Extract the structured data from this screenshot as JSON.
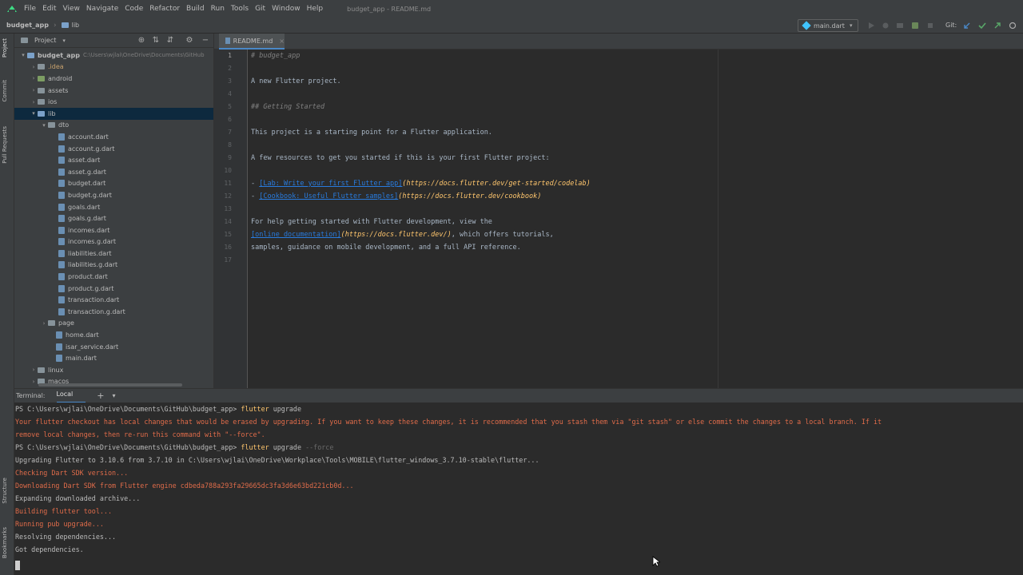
{
  "menubar": {
    "items": [
      "File",
      "Edit",
      "View",
      "Navigate",
      "Code",
      "Refactor",
      "Build",
      "Run",
      "Tools",
      "Git",
      "Window",
      "Help"
    ],
    "window_title": "budget_app - README.md"
  },
  "navbar": {
    "project": "budget_app",
    "folder": "lib",
    "run_config": "main.dart",
    "git_label": "Git:"
  },
  "left_strip": {
    "tabs": [
      "Project",
      "Commit",
      "Pull Requests",
      "Structure",
      "Bookmarks"
    ]
  },
  "project_panel": {
    "title": "Project",
    "tree": [
      {
        "label": "budget_app",
        "path": "C:\\Users\\wjlai\\OneDrive\\Documents\\GitHub",
        "indent": 0,
        "arrow": "▾",
        "type": "folder-blue",
        "bold": true
      },
      {
        "label": ".idea",
        "indent": 1,
        "arrow": "›",
        "type": "folder",
        "idea": true
      },
      {
        "label": "android",
        "indent": 1,
        "arrow": "›",
        "type": "folder-green"
      },
      {
        "label": "assets",
        "indent": 1,
        "arrow": "›",
        "type": "folder"
      },
      {
        "label": "ios",
        "indent": 1,
        "arrow": "›",
        "type": "folder"
      },
      {
        "label": "lib",
        "indent": 1,
        "arrow": "▾",
        "type": "folder-blue",
        "selected": true
      },
      {
        "label": "dto",
        "indent": 2,
        "arrow": "▾",
        "type": "folder"
      },
      {
        "label": "account.dart",
        "indent": 3,
        "arrow": "",
        "type": "file"
      },
      {
        "label": "account.g.dart",
        "indent": 3,
        "arrow": "",
        "type": "file"
      },
      {
        "label": "asset.dart",
        "indent": 3,
        "arrow": "",
        "type": "file"
      },
      {
        "label": "asset.g.dart",
        "indent": 3,
        "arrow": "",
        "type": "file"
      },
      {
        "label": "budget.dart",
        "indent": 3,
        "arrow": "",
        "type": "file"
      },
      {
        "label": "budget.g.dart",
        "indent": 3,
        "arrow": "",
        "type": "file"
      },
      {
        "label": "goals.dart",
        "indent": 3,
        "arrow": "",
        "type": "file"
      },
      {
        "label": "goals.g.dart",
        "indent": 3,
        "arrow": "",
        "type": "file"
      },
      {
        "label": "incomes.dart",
        "indent": 3,
        "arrow": "",
        "type": "file"
      },
      {
        "label": "incomes.g.dart",
        "indent": 3,
        "arrow": "",
        "type": "file"
      },
      {
        "label": "liabilities.dart",
        "indent": 3,
        "arrow": "",
        "type": "file"
      },
      {
        "label": "liabilities.g.dart",
        "indent": 3,
        "arrow": "",
        "type": "file"
      },
      {
        "label": "product.dart",
        "indent": 3,
        "arrow": "",
        "type": "file"
      },
      {
        "label": "product.g.dart",
        "indent": 3,
        "arrow": "",
        "type": "file"
      },
      {
        "label": "transaction.dart",
        "indent": 3,
        "arrow": "",
        "type": "file"
      },
      {
        "label": "transaction.g.dart",
        "indent": 3,
        "arrow": "",
        "type": "file"
      },
      {
        "label": "page",
        "indent": 2,
        "arrow": "›",
        "type": "folder"
      },
      {
        "label": "home.dart",
        "indent": 2,
        "arrow": "",
        "type": "file",
        "noarrow": true
      },
      {
        "label": "isar_service.dart",
        "indent": 2,
        "arrow": "",
        "type": "file",
        "noarrow": true
      },
      {
        "label": "main.dart",
        "indent": 2,
        "arrow": "",
        "type": "file",
        "noarrow": true
      },
      {
        "label": "linux",
        "indent": 1,
        "arrow": "›",
        "type": "folder"
      },
      {
        "label": "macos",
        "indent": 1,
        "arrow": "›",
        "type": "folder"
      }
    ]
  },
  "editor": {
    "tab_label": "README.md",
    "lines": [
      {
        "n": "1",
        "parts": [
          {
            "t": "# budget_app",
            "c": "md-head"
          }
        ]
      },
      {
        "n": "2",
        "parts": []
      },
      {
        "n": "3",
        "parts": [
          {
            "t": "A new Flutter project.",
            "c": ""
          }
        ]
      },
      {
        "n": "4",
        "parts": []
      },
      {
        "n": "5",
        "parts": [
          {
            "t": "## Getting Started",
            "c": "md-head"
          }
        ]
      },
      {
        "n": "6",
        "parts": []
      },
      {
        "n": "7",
        "parts": [
          {
            "t": "This project is a starting point for a Flutter application.",
            "c": ""
          }
        ]
      },
      {
        "n": "8",
        "parts": []
      },
      {
        "n": "9",
        "parts": [
          {
            "t": "A few resources to get you started if this is your first Flutter project:",
            "c": ""
          }
        ]
      },
      {
        "n": "10",
        "parts": []
      },
      {
        "n": "11",
        "parts": [
          {
            "t": "- ",
            "c": ""
          },
          {
            "t": "[Lab: Write your first Flutter app]",
            "c": "md-link"
          },
          {
            "t": "(https://docs.flutter.dev/get-started/codelab)",
            "c": "md-url"
          }
        ]
      },
      {
        "n": "12",
        "parts": [
          {
            "t": "- ",
            "c": ""
          },
          {
            "t": "[Cookbook: Useful Flutter samples]",
            "c": "md-link"
          },
          {
            "t": "(https://docs.flutter.dev/cookbook)",
            "c": "md-url"
          }
        ]
      },
      {
        "n": "13",
        "parts": []
      },
      {
        "n": "14",
        "parts": [
          {
            "t": "For help getting started with Flutter development, view the",
            "c": ""
          }
        ]
      },
      {
        "n": "15",
        "parts": [
          {
            "t": "[online documentation]",
            "c": "md-link"
          },
          {
            "t": "(https://docs.flutter.dev/)",
            "c": "md-url"
          },
          {
            "t": ", which offers tutorials,",
            "c": ""
          }
        ]
      },
      {
        "n": "16",
        "parts": [
          {
            "t": "samples, guidance on mobile development, and a full API reference.",
            "c": ""
          }
        ]
      },
      {
        "n": "17",
        "parts": []
      }
    ]
  },
  "terminal": {
    "title": "Terminal:",
    "tab": "Local",
    "lines": [
      {
        "parts": [
          {
            "t": "PS C:\\Users\\wjlai\\OneDrive\\Documents\\GitHub\\budget_app> ",
            "c": ""
          },
          {
            "t": "flutter",
            "c": "cmd"
          },
          {
            "t": " upgrade",
            "c": ""
          }
        ]
      },
      {
        "err": true,
        "parts": [
          {
            "t": "Your flutter checkout has local changes that would be erased by upgrading. If you want to keep these changes, it is recommended that you stash them via \"git stash\" or else commit the changes to a local branch. If it",
            "c": ""
          }
        ]
      },
      {
        "err": true,
        "parts": [
          {
            "t": "remove local changes, then re-run this command with \"--force\".",
            "c": ""
          }
        ]
      },
      {
        "parts": [
          {
            "t": "PS C:\\Users\\wjlai\\OneDrive\\Documents\\GitHub\\budget_app> ",
            "c": ""
          },
          {
            "t": "flutter",
            "c": "cmd"
          },
          {
            "t": " upgrade ",
            "c": ""
          },
          {
            "t": "--force",
            "c": "flag"
          }
        ]
      },
      {
        "parts": [
          {
            "t": "Upgrading Flutter to 3.10.6 from 3.7.10 in C:\\Users\\wjlai\\OneDrive\\Workplace\\Tools\\MOBILE\\flutter_windows_3.7.10-stable\\flutter...",
            "c": ""
          }
        ]
      },
      {
        "err": true,
        "parts": [
          {
            "t": "Checking Dart SDK version...",
            "c": ""
          }
        ]
      },
      {
        "err": true,
        "parts": [
          {
            "t": "Downloading Dart SDK from Flutter engine cdbeda788a293fa29665dc3fa3d6e63bd221cb0d...",
            "c": ""
          }
        ]
      },
      {
        "parts": [
          {
            "t": "Expanding downloaded archive...",
            "c": ""
          }
        ]
      },
      {
        "err": true,
        "parts": [
          {
            "t": "Building flutter tool...",
            "c": ""
          }
        ]
      },
      {
        "err": true,
        "parts": [
          {
            "t": "Running pub upgrade...",
            "c": ""
          }
        ]
      },
      {
        "parts": [
          {
            "t": "Resolving dependencies...",
            "c": ""
          }
        ]
      },
      {
        "parts": [
          {
            "t": "Got dependencies.",
            "c": ""
          }
        ]
      }
    ]
  },
  "colors": {
    "chrome": "#3c3f41",
    "editor_bg": "#2b2b2b",
    "accent": "#4a88c7",
    "error_text": "#e06c4a",
    "command": "#ffc66d",
    "link": "#287bde"
  }
}
